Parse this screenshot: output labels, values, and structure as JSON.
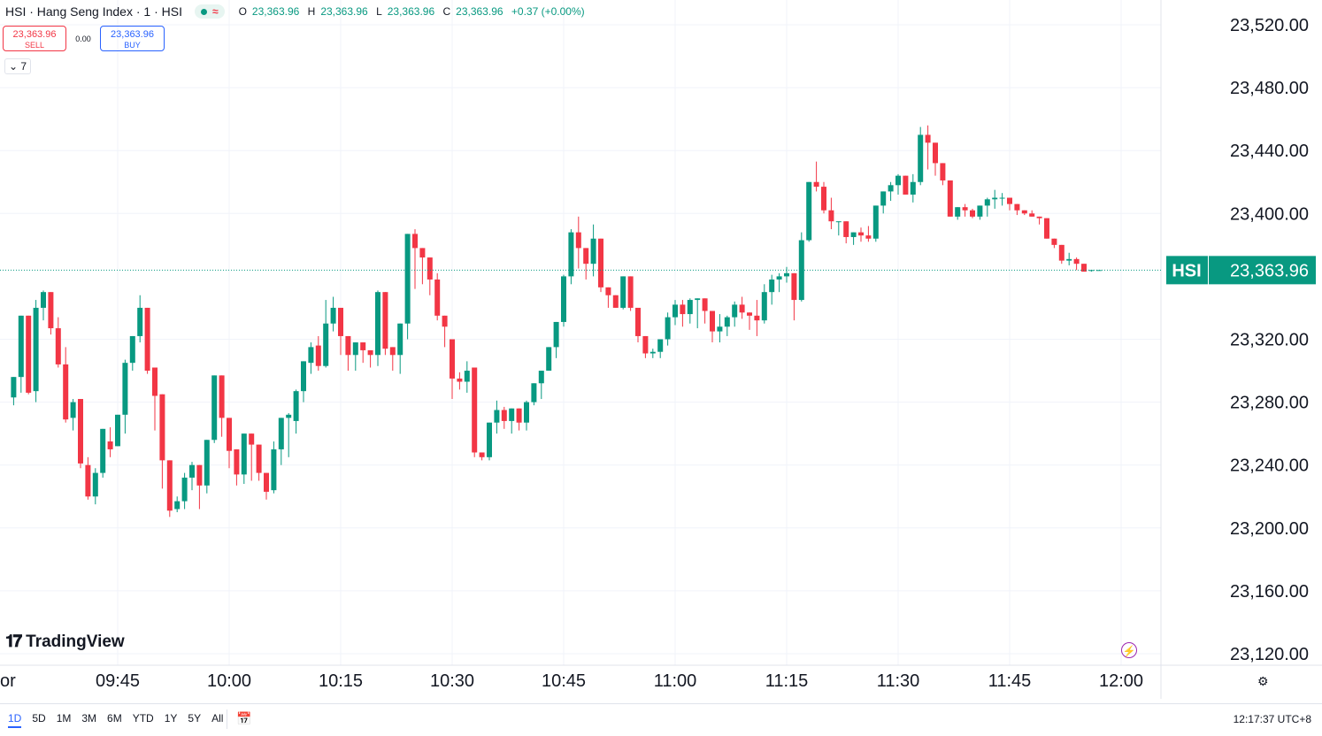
{
  "legend": {
    "symbol_line": "HSI · Hang Seng Index · 1 · HSI",
    "status_wave": "≈",
    "ohlc": {
      "o_label": "O",
      "o": "23,363.96",
      "h_label": "H",
      "h": "23,363.96",
      "l_label": "L",
      "l": "23,363.96",
      "c_label": "C",
      "c": "23,363.96",
      "change": "+0.37 (+0.00%)"
    }
  },
  "trade": {
    "sell_price": "23,363.96",
    "sell_label": "SELL",
    "spread": "0.00",
    "buy_price": "23,363.96",
    "buy_label": "BUY"
  },
  "collapse_count": "7",
  "logo_text": "TradingView",
  "range_buttons": [
    "1D",
    "5D",
    "1M",
    "3M",
    "6M",
    "YTD",
    "1Y",
    "5Y",
    "All"
  ],
  "active_range": "1D",
  "clock": "12:17:37 UTC+8",
  "colors": {
    "up": "#089981",
    "down": "#f23645",
    "grid": "#f0f3fa",
    "axis_text": "#131722"
  },
  "chart_data": {
    "type": "candlestick",
    "symbol": "HSI",
    "last_price": 23363.96,
    "last_price_label": "23,363.96",
    "price_ticks": [
      23520,
      23480,
      23440,
      23400,
      23320,
      23280,
      23240,
      23200,
      23160,
      23120
    ],
    "price_tick_labels": [
      "23,520.00",
      "23,480.00",
      "23,440.00",
      "23,400.00",
      "23,320.00",
      "23,280.00",
      "23,240.00",
      "23,200.00",
      "23,160.00",
      "23,120.00"
    ],
    "ylim": [
      23112,
      23530
    ],
    "time_ticks": [
      {
        "label": "or",
        "minute": "09:31"
      },
      {
        "label": "09:45",
        "minute": "09:45"
      },
      {
        "label": "10:00",
        "minute": "10:00"
      },
      {
        "label": "10:15",
        "minute": "10:15"
      },
      {
        "label": "10:30",
        "minute": "10:30"
      },
      {
        "label": "10:45",
        "minute": "10:45"
      },
      {
        "label": "11:00",
        "minute": "11:00"
      },
      {
        "label": "11:15",
        "minute": "11:15"
      },
      {
        "label": "11:30",
        "minute": "11:30"
      },
      {
        "label": "11:45",
        "minute": "11:45"
      },
      {
        "label": "12:00",
        "minute": "12:00"
      }
    ],
    "first_bar_minute": "09:31",
    "bars": [
      [
        23283,
        23296,
        23278,
        23296
      ],
      [
        23296,
        23335,
        23286,
        23335
      ],
      [
        23335,
        23324,
        23285,
        23286
      ],
      [
        23287,
        23345,
        23280,
        23340
      ],
      [
        23340,
        23351,
        23332,
        23350
      ],
      [
        23350,
        23329,
        23323,
        23327
      ],
      [
        23327,
        23334,
        23302,
        23304
      ],
      [
        23304,
        23315,
        23267,
        23269
      ],
      [
        23270,
        23282,
        23262,
        23280
      ],
      [
        23282,
        23279,
        23238,
        23241
      ],
      [
        23240,
        23245,
        23218,
        23220
      ],
      [
        23220,
        23238,
        23215,
        23235
      ],
      [
        23235,
        23262,
        23232,
        23263
      ],
      [
        23255,
        23264,
        23245,
        23250
      ],
      [
        23252,
        23272,
        23252,
        23272
      ],
      [
        23272,
        23307,
        23260,
        23305
      ],
      [
        23305,
        23322,
        23300,
        23322
      ],
      [
        23322,
        23348,
        23318,
        23340
      ],
      [
        23340,
        23330,
        23298,
        23300
      ],
      [
        23302,
        23285,
        23262,
        23284
      ],
      [
        23285,
        23240,
        23225,
        23243
      ],
      [
        23243,
        23230,
        23207,
        23211
      ],
      [
        23212,
        23220,
        23210,
        23217
      ],
      [
        23217,
        23235,
        23212,
        23232
      ],
      [
        23232,
        23242,
        23224,
        23240
      ],
      [
        23240,
        23228,
        23212,
        23227
      ],
      [
        23227,
        23251,
        23222,
        23256
      ],
      [
        23256,
        23297,
        23254,
        23297
      ],
      [
        23297,
        23282,
        23258,
        23270
      ],
      [
        23270,
        23246,
        23238,
        23249
      ],
      [
        23250,
        23233,
        23227,
        23234
      ],
      [
        23234,
        23260,
        23228,
        23260
      ],
      [
        23260,
        23260,
        23230,
        23253
      ],
      [
        23253,
        23240,
        23230,
        23235
      ],
      [
        23235,
        23223,
        23218,
        23223
      ],
      [
        23224,
        23255,
        23222,
        23250
      ],
      [
        23250,
        23270,
        23240,
        23270
      ],
      [
        23270,
        23273,
        23245,
        23272
      ],
      [
        23268,
        23288,
        23260,
        23287
      ],
      [
        23287,
        23302,
        23280,
        23306
      ],
      [
        23305,
        23318,
        23298,
        23315
      ],
      [
        23316,
        23322,
        23300,
        23303
      ],
      [
        23303,
        23345,
        23302,
        23330
      ],
      [
        23330,
        23347,
        23325,
        23340
      ],
      [
        23340,
        23332,
        23310,
        23322
      ],
      [
        23322,
        23307,
        23300,
        23310
      ],
      [
        23310,
        23304,
        23300,
        23318
      ],
      [
        23318,
        23315,
        23305,
        23313
      ],
      [
        23313,
        23306,
        23302,
        23310
      ],
      [
        23310,
        23351,
        23303,
        23350
      ],
      [
        23350,
        23347,
        23310,
        23314
      ],
      [
        23315,
        23310,
        23300,
        23310
      ],
      [
        23310,
        23318,
        23298,
        23330
      ],
      [
        23330,
        23343,
        23320,
        23387
      ],
      [
        23387,
        23390,
        23352,
        23378
      ],
      [
        23378,
        23376,
        23355,
        23372
      ],
      [
        23372,
        23368,
        23348,
        23358
      ],
      [
        23358,
        23362,
        23332,
        23335
      ],
      [
        23335,
        23329,
        23315,
        23328
      ],
      [
        23320,
        23301,
        23282,
        23295
      ],
      [
        23295,
        23299,
        23288,
        23293
      ],
      [
        23293,
        23306,
        23286,
        23300
      ],
      [
        23302,
        23285,
        23245,
        23248
      ],
      [
        23248,
        23245,
        23243,
        23245
      ],
      [
        23245,
        23266,
        23243,
        23267
      ],
      [
        23267,
        23281,
        23260,
        23275
      ],
      [
        23275,
        23277,
        23263,
        23268
      ],
      [
        23268,
        23272,
        23260,
        23276
      ],
      [
        23276,
        23272,
        23262,
        23267
      ],
      [
        23267,
        23281,
        23262,
        23280
      ],
      [
        23280,
        23289,
        23278,
        23292
      ],
      [
        23292,
        23300,
        23282,
        23300
      ],
      [
        23300,
        23310,
        23302,
        23315
      ],
      [
        23315,
        23331,
        23308,
        23331
      ],
      [
        23331,
        23361,
        23328,
        23360
      ],
      [
        23360,
        23390,
        23355,
        23388
      ],
      [
        23388,
        23398,
        23365,
        23378
      ],
      [
        23378,
        23370,
        23358,
        23368
      ],
      [
        23368,
        23393,
        23360,
        23384
      ],
      [
        23384,
        23377,
        23350,
        23353
      ],
      [
        23353,
        23339,
        23340,
        23348
      ],
      [
        23348,
        23338,
        23340,
        23340
      ],
      [
        23340,
        23357,
        23339,
        23360
      ],
      [
        23360,
        23355,
        23338,
        23340
      ],
      [
        23340,
        23325,
        23318,
        23322
      ],
      [
        23322,
        23310,
        23308,
        23311
      ],
      [
        23311,
        23314,
        23308,
        23312
      ],
      [
        23312,
        23317,
        23308,
        23320
      ],
      [
        23320,
        23337,
        23316,
        23334
      ],
      [
        23334,
        23345,
        23329,
        23342
      ],
      [
        23342,
        23345,
        23328,
        23336
      ],
      [
        23336,
        23346,
        23330,
        23345
      ],
      [
        23345,
        23339,
        23327,
        23346
      ],
      [
        23346,
        23345,
        23330,
        23338
      ],
      [
        23338,
        23332,
        23318,
        23325
      ],
      [
        23325,
        23336,
        23318,
        23328
      ],
      [
        23328,
        23335,
        23322,
        23334
      ],
      [
        23334,
        23344,
        23328,
        23342
      ],
      [
        23342,
        23347,
        23333,
        23337
      ],
      [
        23337,
        23335,
        23326,
        23335
      ],
      [
        23335,
        23345,
        23322,
        23332
      ],
      [
        23332,
        23355,
        23330,
        23350
      ],
      [
        23350,
        23361,
        23342,
        23358
      ],
      [
        23358,
        23362,
        23350,
        23360
      ],
      [
        23360,
        23366,
        23356,
        23362
      ],
      [
        23362,
        23360,
        23332,
        23345
      ],
      [
        23345,
        23388,
        23344,
        23383
      ],
      [
        23383,
        23420,
        23382,
        23420
      ],
      [
        23420,
        23433,
        23414,
        23417
      ],
      [
        23417,
        23420,
        23400,
        23402
      ],
      [
        23402,
        23410,
        23390,
        23395
      ],
      [
        23395,
        23394,
        23386,
        23395
      ],
      [
        23395,
        23393,
        23381,
        23385
      ],
      [
        23385,
        23388,
        23380,
        23388
      ],
      [
        23388,
        23391,
        23382,
        23386
      ],
      [
        23386,
        23392,
        23382,
        23384
      ],
      [
        23384,
        23405,
        23382,
        23405
      ],
      [
        23405,
        23413,
        23400,
        23414
      ],
      [
        23414,
        23420,
        23408,
        23418
      ],
      [
        23418,
        23425,
        23412,
        23424
      ],
      [
        23424,
        23422,
        23412,
        23412
      ],
      [
        23412,
        23425,
        23407,
        23420
      ],
      [
        23420,
        23455,
        23418,
        23450
      ],
      [
        23450,
        23456,
        23428,
        23445
      ],
      [
        23445,
        23435,
        23424,
        23432
      ],
      [
        23432,
        23420,
        23418,
        23421
      ],
      [
        23421,
        23415,
        23398,
        23398
      ],
      [
        23398,
        23402,
        23396,
        23404
      ],
      [
        23404,
        23406,
        23398,
        23402
      ],
      [
        23402,
        23403,
        23397,
        23398
      ],
      [
        23398,
        23404,
        23396,
        23405
      ],
      [
        23405,
        23410,
        23398,
        23409
      ],
      [
        23409,
        23415,
        23403,
        23410
      ],
      [
        23410,
        23413,
        23405,
        23410
      ],
      [
        23410,
        23405,
        23402,
        23406
      ],
      [
        23406,
        23399,
        23399,
        23402
      ],
      [
        23402,
        23398,
        23399,
        23400
      ],
      [
        23400,
        23402,
        23398,
        23398
      ],
      [
        23398,
        23395,
        23393,
        23397
      ],
      [
        23397,
        23396,
        23385,
        23384
      ],
      [
        23384,
        23380,
        23378,
        23380
      ],
      [
        23380,
        23375,
        23368,
        23370
      ],
      [
        23370,
        23375,
        23367,
        23371
      ],
      [
        23371,
        23372,
        23364,
        23368
      ],
      [
        23368,
        23362,
        23365,
        23363
      ],
      [
        23364,
        23364,
        23363,
        23364
      ],
      [
        23364,
        23364,
        23364,
        23364
      ]
    ]
  }
}
